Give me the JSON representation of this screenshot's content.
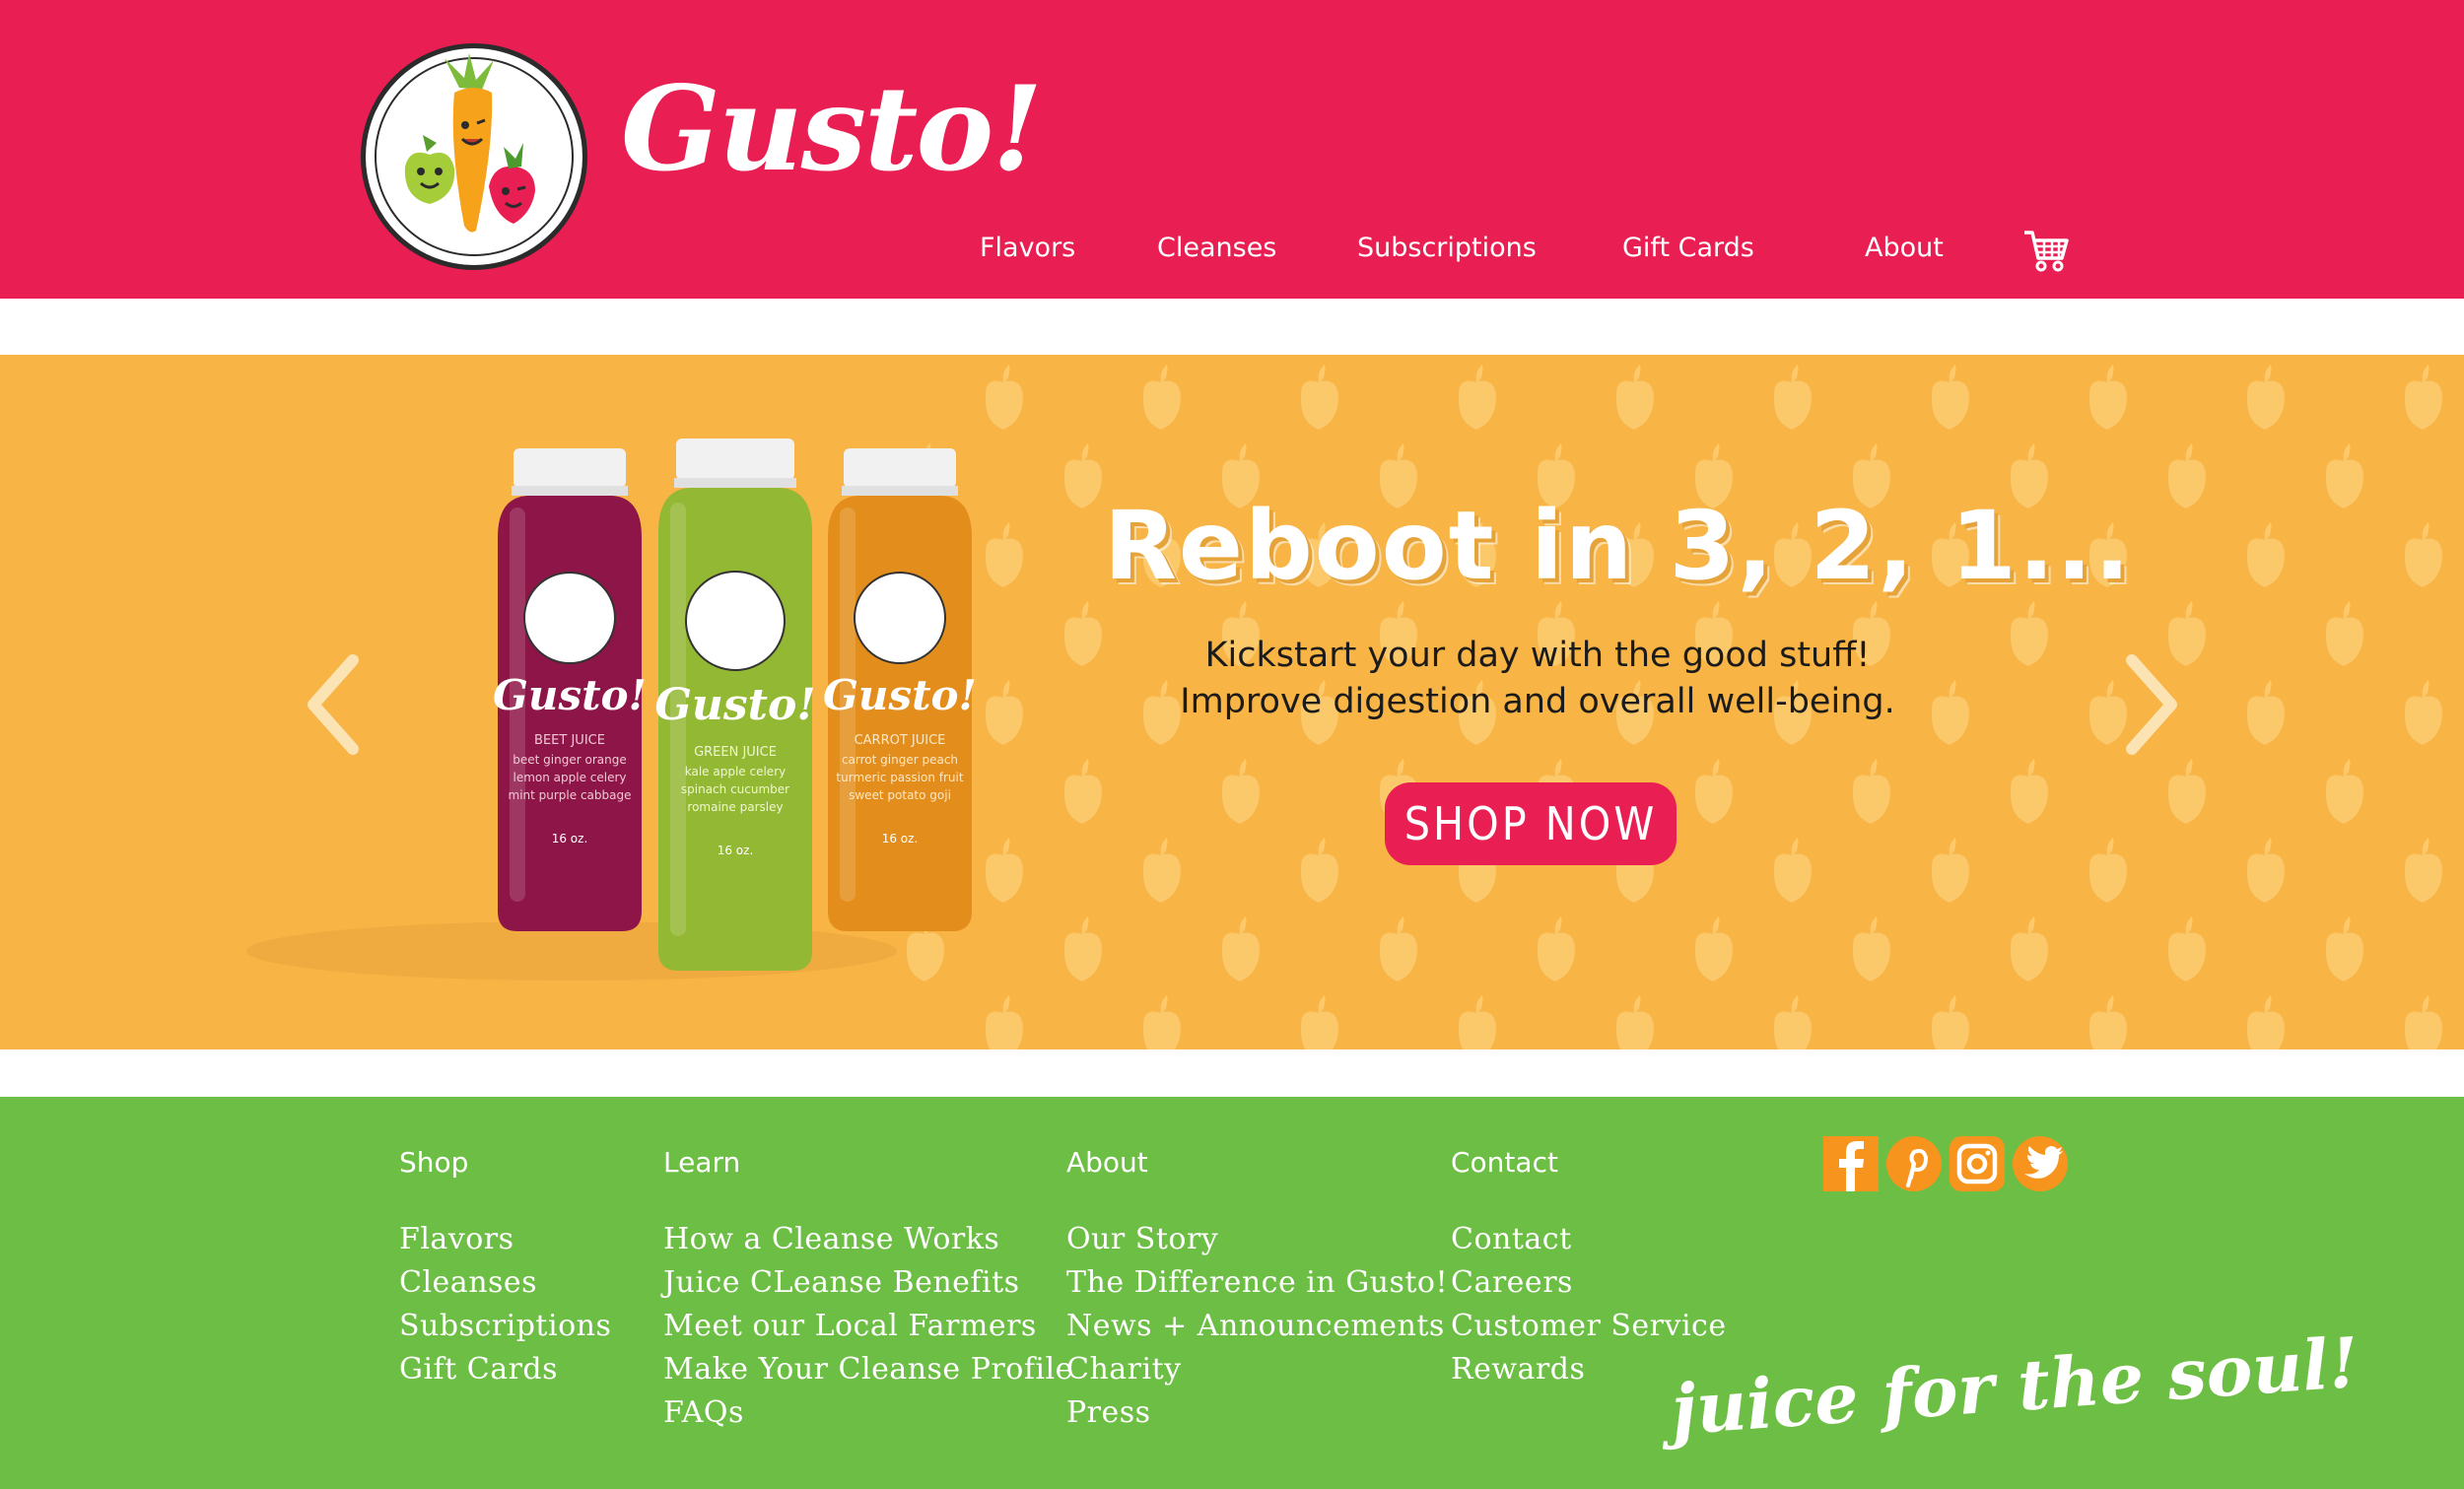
{
  "brand": {
    "wordmark": "Gusto!",
    "primary_color": "#E91E52",
    "hero_color": "#F8B444",
    "footer_color": "#6DBE45"
  },
  "nav": {
    "items": [
      {
        "label": "Flavors"
      },
      {
        "label": "Cleanses"
      },
      {
        "label": "Subscriptions"
      },
      {
        "label": "Gift Cards"
      },
      {
        "label": "About"
      }
    ],
    "cart_icon": "shopping-cart-icon"
  },
  "hero": {
    "headline": "Reboot in 3, 2, 1...",
    "subline_1": "Kickstart your day with the good stuff!",
    "subline_2": "Improve digestion and overall well-being.",
    "cta_label": "SHOP NOW",
    "prev_icon": "chevron-left-icon",
    "next_icon": "chevron-right-icon",
    "bottles": [
      {
        "brand": "Gusto!",
        "name": "BEET JUICE",
        "ingredients_1": "beet ginger orange",
        "ingredients_2": "lemon apple celery",
        "ingredients_3": "mint purple cabbage",
        "size": "16 oz.",
        "color": "#8E1547"
      },
      {
        "brand": "Gusto!",
        "name": "GREEN JUICE",
        "ingredients_1": "kale apple celery",
        "ingredients_2": "spinach cucumber",
        "ingredients_3": "romaine parsley",
        "size": "16 oz.",
        "color": "#93B833"
      },
      {
        "brand": "Gusto!",
        "name": "CARROT JUICE",
        "ingredients_1": "carrot ginger peach",
        "ingredients_2": "turmeric passion fruit",
        "ingredients_3": "sweet potato goji",
        "size": "16 oz.",
        "color": "#E38E1C"
      }
    ]
  },
  "footer": {
    "columns": [
      {
        "heading": "Shop",
        "links": [
          "Flavors",
          "Cleanses",
          "Subscriptions",
          "Gift Cards"
        ]
      },
      {
        "heading": "Learn",
        "links": [
          "How a Cleanse Works",
          "Juice CLeanse Benefits",
          "Meet our Local Farmers",
          "Make Your Cleanse Profile",
          "FAQs"
        ]
      },
      {
        "heading": "About",
        "links": [
          "Our Story",
          "The Difference in Gusto!",
          "News + Announcements",
          "Charity",
          "Press"
        ]
      },
      {
        "heading": "Contact",
        "links": [
          "Contact",
          "Careers",
          "Customer Service",
          "Rewards"
        ]
      }
    ],
    "social": [
      "facebook-icon",
      "pinterest-icon",
      "instagram-icon",
      "twitter-icon"
    ],
    "social_color": "#F7941D",
    "tagline": "juice for the soul!"
  }
}
